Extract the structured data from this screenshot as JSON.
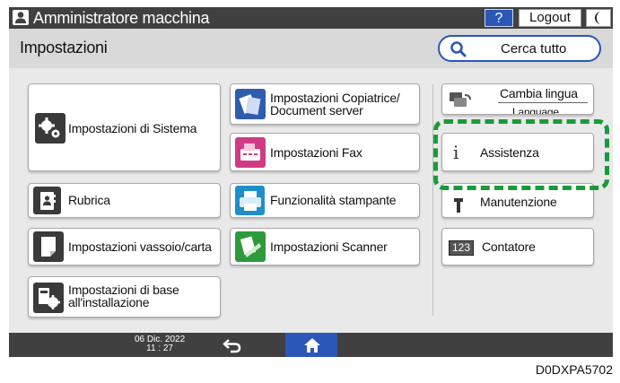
{
  "topbar": {
    "user_icon": "user-icon",
    "title": "Amministratore macchina",
    "help_label": "?",
    "logout_label": "Logout",
    "energy_icon": "energy-saver-icon"
  },
  "header": {
    "title": "Impostazioni",
    "search_label": "Cerca tutto",
    "search_icon": "search-icon"
  },
  "left_column": [
    {
      "label": "Impostazioni di Sistema",
      "icon": "system-gears-icon"
    },
    {
      "label": "Rubrica",
      "icon": "address-book-icon"
    },
    {
      "label": "Impostazioni vassoio/carta",
      "icon": "paper-tray-icon"
    },
    {
      "label_line1": "Impostazioni di base",
      "label_line2": "all'installazione",
      "icon": "installation-settings-icon"
    }
  ],
  "middle_column": [
    {
      "label_line1": "Impostazioni Copiatrice/",
      "label_line2": "Document server",
      "icon": "copier-icon"
    },
    {
      "label": "Impostazioni Fax",
      "icon": "fax-icon"
    },
    {
      "label": "Funzionalità stampante",
      "icon": "printer-icon"
    },
    {
      "label": "Impostazioni Scanner",
      "icon": "scanner-icon"
    }
  ],
  "right_column": {
    "language": {
      "label": "Cambia lingua",
      "sub_label": "Language",
      "icon": "change-language-icon"
    },
    "assistance": {
      "label": "Assistenza",
      "icon": "info-icon"
    },
    "maintenance": {
      "label": "Manutenzione",
      "icon": "maintenance-icon"
    },
    "counter": {
      "label": "Contatore",
      "badge": "123",
      "icon": "counter-icon"
    }
  },
  "highlight_color": "#1a9a3c",
  "bottom": {
    "date": "06 Dic. 2022",
    "time": "11 : 27",
    "back_icon": "back-arrow-icon",
    "home_icon": "home-icon"
  },
  "image_code": "D0DXPA5702"
}
